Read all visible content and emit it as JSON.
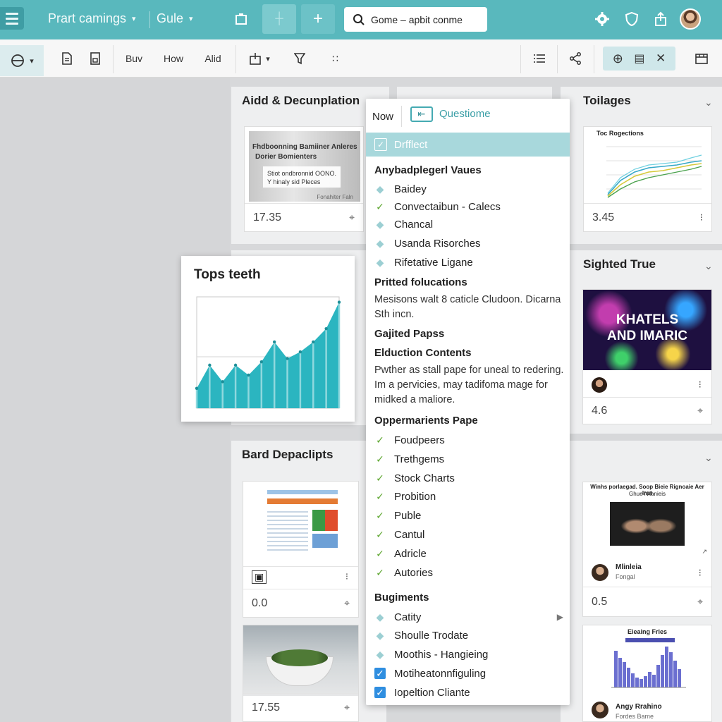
{
  "header": {
    "nav1": "Prart camings",
    "nav2": "Gule",
    "search_value": "Gome – apbit conme"
  },
  "toolbar": {
    "btn1": "Buv",
    "btn2": "How",
    "btn3": "Alid"
  },
  "columns": [
    {
      "title": "Aidd & Decunplation",
      "cards": [
        {
          "thumb_title": "Fhdboonning Bamiiner Anleres",
          "thumb_title2": "Dorier Bomienters",
          "thumb_line1": "Stiot ondbronnid OONO.",
          "thumb_line2": "Y hinaly sid Pleces",
          "thumb_footer": "Fonahiter Faln",
          "value": "17.35"
        }
      ]
    },
    {
      "title": "Bard Depaclipts",
      "cards": [
        {
          "value": "0.0"
        },
        {
          "value": "17.55"
        }
      ]
    },
    {
      "title": "Toilages",
      "cards": [
        {
          "thumb_title": "Toc Rogections",
          "value": "3.45"
        }
      ]
    },
    {
      "title": "Sighted True",
      "cards": [
        {
          "thumb_line1": "KHATELS",
          "thumb_line2": "AND IMARIC",
          "value": "4.6"
        },
        {
          "thumb_title": "Winhs porlaegad. Soop Bieie Rignoaie Aer Inst",
          "thumb_title2": "Ghue Nilanieis",
          "person": "Mlinleia",
          "person_sub": "Fongal",
          "value": "0.5"
        },
        {
          "thumb_title": "Eieaing Fries",
          "person": "Angy Rrahino",
          "person_sub": "Fordes Bame"
        }
      ]
    }
  ],
  "floating_card": {
    "title": "Tops teeth",
    "chart_values": [
      6,
      13,
      8,
      13,
      10,
      14,
      20,
      15,
      17,
      20,
      24,
      32
    ],
    "color": "#2bb5c0"
  },
  "dropdown": {
    "now_label": "Now",
    "question_label": "Questiome",
    "highlight_label": "Drfflect",
    "sections": {
      "s1": "Anybadplegerl Vaues",
      "s2": "Pritted folucations",
      "s3": "Gajited Papss",
      "s4": "Elduction Contents",
      "s5": "Oppermarients Pape",
      "s6": "Bugiments"
    },
    "items_a": [
      "Baidey",
      "Convectaibun - Calecs",
      "Chancal",
      "Usanda Risorches",
      "Rifetative Ligane"
    ],
    "para1": "Mesisons walt 8 caticle Cludoon. Dicarna Sth incn.",
    "para2": "Pwther as stall pape for uneal to redering. Im a pervicies, may tadifoma mage for midked a maliore.",
    "items_b": [
      "Foudpeers",
      "Trethgems",
      "Stock Charts",
      "Probition",
      "Puble",
      "Cantul",
      "Adricle",
      "Autories"
    ],
    "items_c": [
      "Catity",
      "Shoulle Trodate",
      "Moothis - Hangieing",
      "Motiheatonnfiguling",
      "Iopeltion Cliante"
    ]
  }
}
